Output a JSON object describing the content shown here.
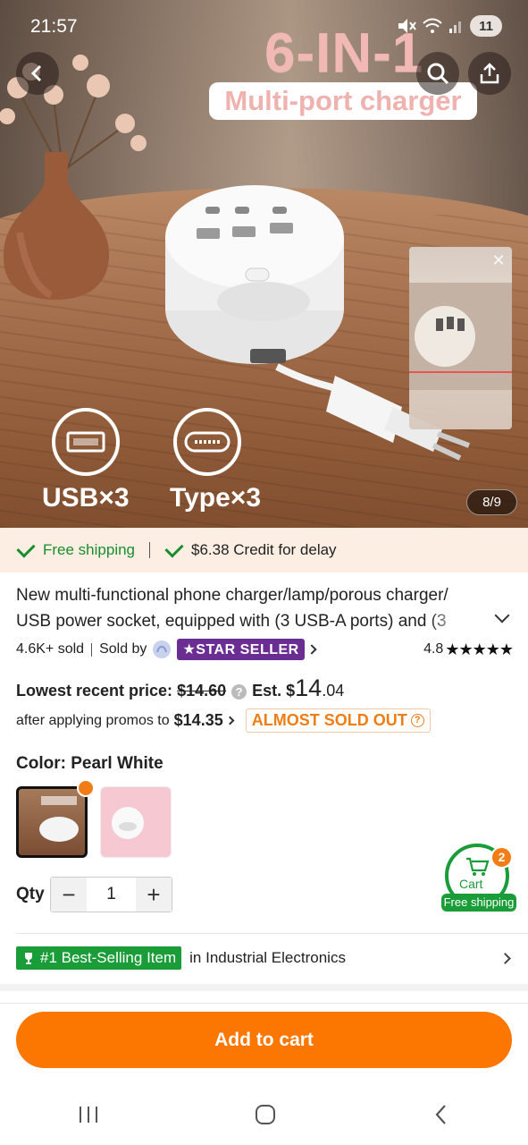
{
  "status_bar": {
    "time": "21:57",
    "battery": "11"
  },
  "hero": {
    "title": "6-IN-1",
    "subtitle": "Multi-port charger",
    "feature_usb": "USB×3",
    "feature_typec": "Type×3",
    "image_counter": "8/9"
  },
  "shipping": {
    "free_shipping": "Free shipping",
    "credit": "$6.38 Credit for delay"
  },
  "product": {
    "title": "New multi-functional phone charger/lamp/porous charger/ USB power socket, equipped with (3 USB-A ports) and (3",
    "sold": "4.6K+ sold",
    "sold_by": "Sold by",
    "seller_badge": "STAR  SELLER",
    "rating": "4.8",
    "stars": "★★★★★"
  },
  "price": {
    "lowest_label": "Lowest recent price:",
    "original": "$14.60",
    "est_label": "Est. $",
    "est_dollars": "14",
    "est_cents": ".04",
    "after_promos_label": "after applying promos to",
    "after_promos_value": "$14.35",
    "almost_sold_out": "ALMOST SOLD OUT"
  },
  "color": {
    "label": "Color: Pearl White"
  },
  "quantity": {
    "label": "Qty",
    "value": "1",
    "minus": "−",
    "plus": "+"
  },
  "cart": {
    "count": "2",
    "label": "Cart",
    "free_shipping": "Free shipping"
  },
  "best_selling": {
    "tag": "#1 Best-Selling Item",
    "category": "in Industrial Electronics"
  },
  "actions": {
    "add_to_cart": "Add to cart"
  },
  "colors": {
    "accent": "#fb7701",
    "green": "#1a9c39",
    "star_seller": "#6a2d91",
    "ship_bg": "#fdeee4"
  }
}
